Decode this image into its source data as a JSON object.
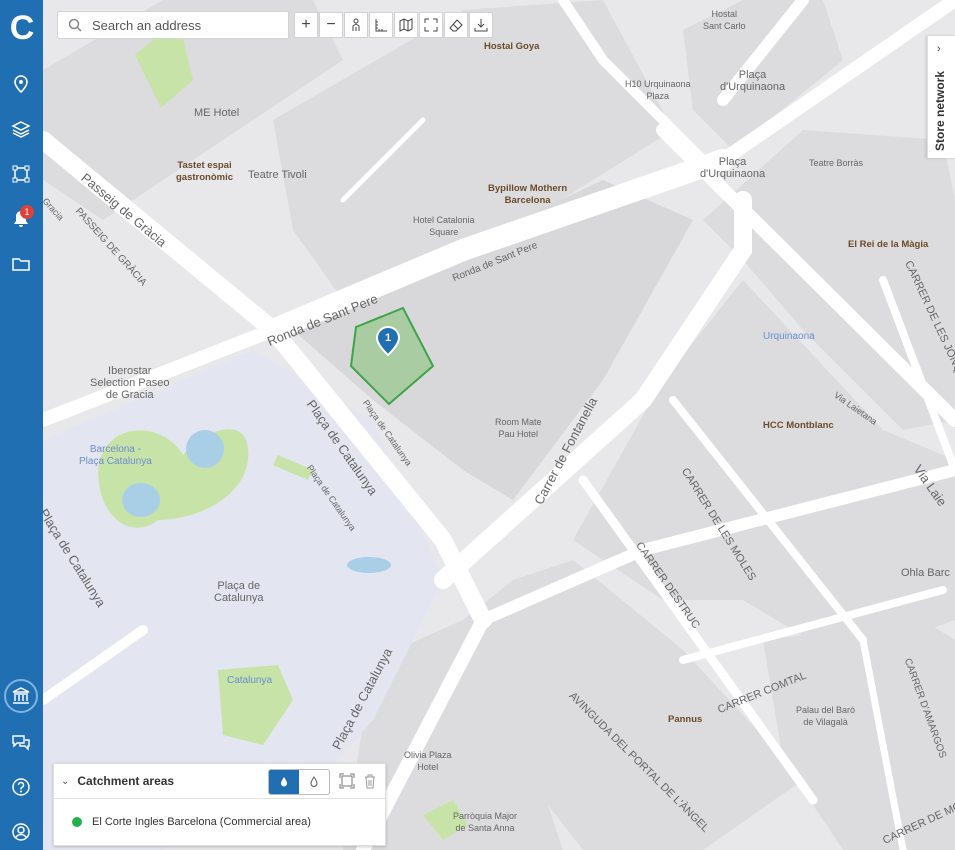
{
  "sidebar": {
    "logo": "C",
    "icons": [
      "location-icon",
      "layers-icon",
      "polygon-icon",
      "bell-icon",
      "folder-icon",
      "bank-icon",
      "chat-icon",
      "help-icon",
      "user-icon"
    ],
    "notification_count": "1"
  },
  "toolbar": {
    "search_placeholder": "Search an address",
    "buttons": [
      "zoom-in",
      "zoom-out",
      "street-view",
      "ruler",
      "map",
      "fullscreen",
      "eraser",
      "download"
    ]
  },
  "store_network_tab": {
    "label": "Store network"
  },
  "catchment_panel": {
    "title": "Catchment areas",
    "item_label": "El Corte Ingles Barcelona (Commercial area)",
    "item_color": "#22b14c"
  },
  "map": {
    "marker_label": "1",
    "places": {
      "hostal_goya": "Hostal Goya",
      "hostal_santcarlo": "Hostal\nSant Carlo",
      "h10": "H10 Urquinaona\nPlaza",
      "placa_urq1": "Plaça\nd'Urquinaona",
      "placa_urq2": "Plaça\nd'Urquinaona",
      "me_hotel": "ME Hotel",
      "tastet": "Tastet espai\ngastronòmic",
      "teatre_tivoli": "Teatre Tivoli",
      "bypillow": "Bypillow Mothern\nBarcelona",
      "hotel_catalonia": "Hotel Catalonia\nSquare",
      "teatre_borras": "Teatre Borràs",
      "rei_magia": "El Rei de la Màgia",
      "urquinaona_metro": "Urquinaona",
      "iberostar": "Iberostar\nSelection Paseo\nde Gracia",
      "barcelona_pc": "Barcelona -\nPlaça Catalunya",
      "room_mate": "Room Mate\nPau Hotel",
      "hcc": "HCC Montblanc",
      "placa_cat": "Plaça de\nCatalunya",
      "catalunya_metro": "Catalunya",
      "ohla": "Ohla Barc",
      "pannus": "Pannus",
      "palau_baro": "Palau del Baró\nde Vilagalà",
      "olivia": "Olivia Plaza\nHotel",
      "parroquia": "Parròquia Major\nde Santa Anna"
    },
    "streets": {
      "passeig_gracia": "Passeig de Gràcia",
      "passeig_gracia_caps": "PASSEIG DE GRÀCIA",
      "gracia": "Gracia",
      "ronda_sant_pere": "Ronda de Sant Pere",
      "ronda_sant_pere_small": "Ronda de Sant Pere",
      "placa_catalunya_a": "Plaça de Catalunya",
      "placa_catalunya_small": "Plaça de Catalunya",
      "placa_catalunya_b": "Plaça de Catalunya",
      "placa_catalunya_c": "Plaça de Catalunya",
      "placa_catalunya_left": "Plaça de Catalunya",
      "carrer_fontanella": "Carrer de Fontanella",
      "carrer_moles": "CARRER DE LES MOLES",
      "carrer_destruc": "CARRER DESTRUC",
      "carrer_comtal": "CARRER COMTAL",
      "avinguda_portal": "AVINGUDA DEL PORTAL DE L'ÀNGEL",
      "carrer_jonq": "CARRER DE LES JONQ",
      "via_laietana": "Via Laie",
      "via_laietana_small": "Via Laietana",
      "carrer_amargos": "CARRER D'AMARGOS",
      "carrer_mo": "CARRER DE MO"
    }
  }
}
